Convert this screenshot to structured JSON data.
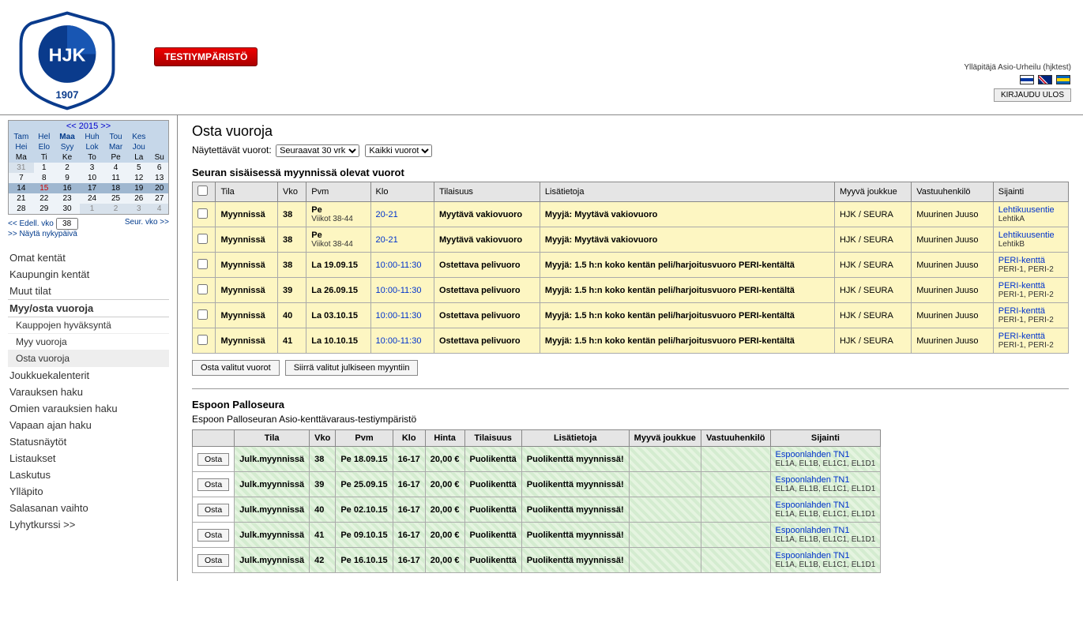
{
  "env_badge": "TESTIYMPÄRISTÖ",
  "user_line": "Ylläpitäjä Asio-Urheilu (hjktest)",
  "logout": "KIRJAUDU ULOS",
  "calendar": {
    "year": "2015",
    "prev": "<<",
    "next": ">>",
    "months_row1": [
      "Tam",
      "Hel",
      "Maa",
      "Huh",
      "Tou",
      "Kes"
    ],
    "months_row2": [
      "Hei",
      "Elo",
      "Syy",
      "Lok",
      "Mar",
      "Jou"
    ],
    "weekdays": [
      "Ma",
      "Ti",
      "Ke",
      "To",
      "Pe",
      "La",
      "Su"
    ],
    "weeks": [
      [
        "31",
        "1",
        "2",
        "3",
        "4",
        "5",
        "6"
      ],
      [
        "7",
        "8",
        "9",
        "10",
        "11",
        "12",
        "13"
      ],
      [
        "14",
        "15",
        "16",
        "17",
        "18",
        "19",
        "20"
      ],
      [
        "21",
        "22",
        "23",
        "24",
        "25",
        "26",
        "27"
      ],
      [
        "28",
        "29",
        "30",
        "1",
        "2",
        "3",
        "4"
      ]
    ]
  },
  "cal_nav": {
    "prev": "<< Edell. vko",
    "week": "38",
    "next": "Seur. vko >>",
    "today": ">> Näytä nykypäivä"
  },
  "nav": [
    {
      "label": "Omat kentät"
    },
    {
      "label": "Kaupungin kentät"
    },
    {
      "label": "Muut tilat"
    },
    {
      "label": "Myy/osta vuoroja",
      "active": true
    },
    {
      "label": "Kauppojen hyväksyntä",
      "sub": true
    },
    {
      "label": "Myy vuoroja",
      "sub": true
    },
    {
      "label": "Osta vuoroja",
      "sub": true,
      "selected": true
    },
    {
      "label": "Joukkuekalenterit"
    },
    {
      "label": "Varauksen haku"
    },
    {
      "label": "Omien varauksien haku"
    },
    {
      "label": "Vapaan ajan haku"
    },
    {
      "label": "Statusnäytöt"
    },
    {
      "label": "Listaukset"
    },
    {
      "label": "Laskutus"
    },
    {
      "label": "Ylläpito"
    },
    {
      "label": "Salasanan vaihto"
    },
    {
      "label": "Lyhytkurssi >>"
    }
  ],
  "page_title": "Osta vuoroja",
  "filter_label": "Näytettävät vuorot:",
  "filter_period": "Seuraavat 30 vrk",
  "filter_all": "Kaikki vuorot",
  "section1_title": "Seuran sisäisessä myynnissä olevat vuorot",
  "table1_headers": [
    "",
    "Tila",
    "Vko",
    "Pvm",
    "Klo",
    "Tilaisuus",
    "Lisätietoja",
    "Myyvä joukkue",
    "Vastuuhenkilö",
    "Sijainti"
  ],
  "table1_rows": [
    {
      "tila": "Myynnissä",
      "vko": "38",
      "pvm": "Pe",
      "pvm_sub": "Viikot 38-44",
      "klo": "20-21",
      "tilaisuus": "Myytävä vakiovuoro",
      "lisatietoja": "Myyjä: Myytävä vakiovuoro",
      "joukkue": "HJK / SEURA",
      "vastuu": "Muurinen Juuso",
      "sij_link": "Lehtikuusentie",
      "sij_sub": "LehtikA"
    },
    {
      "tila": "Myynnissä",
      "vko": "38",
      "pvm": "Pe",
      "pvm_sub": "Viikot 38-44",
      "klo": "20-21",
      "tilaisuus": "Myytävä vakiovuoro",
      "lisatietoja": "Myyjä: Myytävä vakiovuoro",
      "joukkue": "HJK / SEURA",
      "vastuu": "Muurinen Juuso",
      "sij_link": "Lehtikuusentie",
      "sij_sub": "LehtikB"
    },
    {
      "tila": "Myynnissä",
      "vko": "38",
      "pvm": "La 19.09.15",
      "pvm_sub": "",
      "klo": "10:00-11:30",
      "tilaisuus": "Ostettava pelivuoro",
      "lisatietoja": "Myyjä: 1.5 h:n koko kentän peli/harjoitusvuoro PERI-kentältä",
      "joukkue": "HJK / SEURA",
      "vastuu": "Muurinen Juuso",
      "sij_link": "PERI-kenttä",
      "sij_sub": "PERI-1, PERI-2"
    },
    {
      "tila": "Myynnissä",
      "vko": "39",
      "pvm": "La 26.09.15",
      "pvm_sub": "",
      "klo": "10:00-11:30",
      "tilaisuus": "Ostettava pelivuoro",
      "lisatietoja": "Myyjä: 1.5 h:n koko kentän peli/harjoitusvuoro PERI-kentältä",
      "joukkue": "HJK / SEURA",
      "vastuu": "Muurinen Juuso",
      "sij_link": "PERI-kenttä",
      "sij_sub": "PERI-1, PERI-2"
    },
    {
      "tila": "Myynnissä",
      "vko": "40",
      "pvm": "La 03.10.15",
      "pvm_sub": "",
      "klo": "10:00-11:30",
      "tilaisuus": "Ostettava pelivuoro",
      "lisatietoja": "Myyjä: 1.5 h:n koko kentän peli/harjoitusvuoro PERI-kentältä",
      "joukkue": "HJK / SEURA",
      "vastuu": "Muurinen Juuso",
      "sij_link": "PERI-kenttä",
      "sij_sub": "PERI-1, PERI-2"
    },
    {
      "tila": "Myynnissä",
      "vko": "41",
      "pvm": "La 10.10.15",
      "pvm_sub": "",
      "klo": "10:00-11:30",
      "tilaisuus": "Ostettava pelivuoro",
      "lisatietoja": "Myyjä: 1.5 h:n koko kentän peli/harjoitusvuoro PERI-kentältä",
      "joukkue": "HJK / SEURA",
      "vastuu": "Muurinen Juuso",
      "sij_link": "PERI-kenttä",
      "sij_sub": "PERI-1, PERI-2"
    }
  ],
  "btn_buy_selected": "Osta valitut vuorot",
  "btn_move_public": "Siirrä valitut julkiseen myyntiin",
  "section2_title": "Espoon Palloseura",
  "section2_desc": "Espoon Palloseuran Asio-kenttävaraus-testiympäristö",
  "table2_headers": [
    "",
    "Tila",
    "Vko",
    "Pvm",
    "Klo",
    "Hinta",
    "Tilaisuus",
    "Lisätietoja",
    "Myyvä joukkue",
    "Vastuuhenkilö",
    "Sijainti"
  ],
  "btn_osta": "Osta",
  "table2_rows": [
    {
      "tila": "Julk.myynnissä",
      "vko": "38",
      "pvm": "Pe 18.09.15",
      "klo": "16-17",
      "hinta": "20,00 €",
      "tilaisuus": "Puolikenttä",
      "lisatietoja": "Puolikenttä myynnissä!",
      "joukkue": "",
      "vastuu": "",
      "sij_link": "Espoonlahden TN1",
      "sij_sub": "EL1A, EL1B, EL1C1, EL1D1"
    },
    {
      "tila": "Julk.myynnissä",
      "vko": "39",
      "pvm": "Pe 25.09.15",
      "klo": "16-17",
      "hinta": "20,00 €",
      "tilaisuus": "Puolikenttä",
      "lisatietoja": "Puolikenttä myynnissä!",
      "joukkue": "",
      "vastuu": "",
      "sij_link": "Espoonlahden TN1",
      "sij_sub": "EL1A, EL1B, EL1C1, EL1D1"
    },
    {
      "tila": "Julk.myynnissä",
      "vko": "40",
      "pvm": "Pe 02.10.15",
      "klo": "16-17",
      "hinta": "20,00 €",
      "tilaisuus": "Puolikenttä",
      "lisatietoja": "Puolikenttä myynnissä!",
      "joukkue": "",
      "vastuu": "",
      "sij_link": "Espoonlahden TN1",
      "sij_sub": "EL1A, EL1B, EL1C1, EL1D1"
    },
    {
      "tila": "Julk.myynnissä",
      "vko": "41",
      "pvm": "Pe 09.10.15",
      "klo": "16-17",
      "hinta": "20,00 €",
      "tilaisuus": "Puolikenttä",
      "lisatietoja": "Puolikenttä myynnissä!",
      "joukkue": "",
      "vastuu": "",
      "sij_link": "Espoonlahden TN1",
      "sij_sub": "EL1A, EL1B, EL1C1, EL1D1"
    },
    {
      "tila": "Julk.myynnissä",
      "vko": "42",
      "pvm": "Pe 16.10.15",
      "klo": "16-17",
      "hinta": "20,00 €",
      "tilaisuus": "Puolikenttä",
      "lisatietoja": "Puolikenttä myynnissä!",
      "joukkue": "",
      "vastuu": "",
      "sij_link": "Espoonlahden TN1",
      "sij_sub": "EL1A, EL1B, EL1C1, EL1D1"
    }
  ]
}
